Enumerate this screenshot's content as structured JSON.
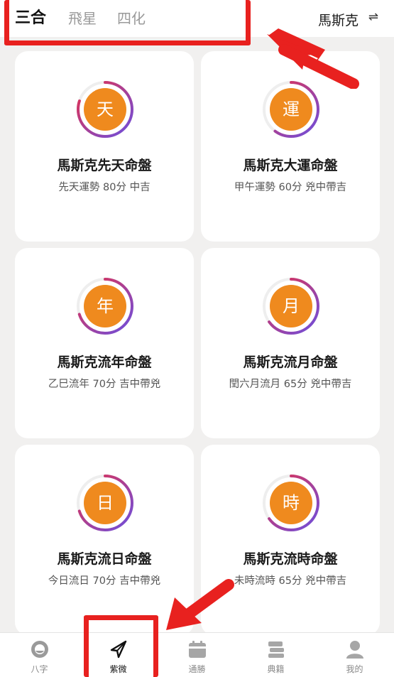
{
  "header": {
    "tabs": [
      {
        "label": "三合",
        "active": true
      },
      {
        "label": "飛星",
        "active": false
      },
      {
        "label": "四化",
        "active": false
      }
    ],
    "user_name": "馬斯克",
    "switch_icon": "⇌"
  },
  "cards": [
    {
      "badge": "天",
      "title": "馬斯克先天命盤",
      "subtitle": "先天運勢  80分 中吉",
      "score": 80
    },
    {
      "badge": "運",
      "title": "馬斯克大運命盤",
      "subtitle": "甲午運勢  60分 兇中帶吉",
      "score": 60
    },
    {
      "badge": "年",
      "title": "馬斯克流年命盤",
      "subtitle": "乙巳流年  70分 吉中帶兇",
      "score": 70
    },
    {
      "badge": "月",
      "title": "馬斯克流月命盤",
      "subtitle": "閏六月流月  65分 兇中帶吉",
      "score": 65
    },
    {
      "badge": "日",
      "title": "馬斯克流日命盤",
      "subtitle": "今日流日  70分 吉中帶兇",
      "score": 70
    },
    {
      "badge": "時",
      "title": "馬斯克流時命盤",
      "subtitle": "未時流時 65分 兇中帶吉",
      "score": 65
    }
  ],
  "bottom_nav": [
    {
      "label": "八字",
      "icon": "bazi-icon",
      "active": false
    },
    {
      "label": "紫微",
      "icon": "ziwei-icon",
      "active": true
    },
    {
      "label": "通勝",
      "icon": "calendar-icon",
      "active": false
    },
    {
      "label": "典籍",
      "icon": "books-icon",
      "active": false
    },
    {
      "label": "我的",
      "icon": "profile-icon",
      "active": false
    }
  ],
  "colors": {
    "accent": "#ef8a1e",
    "ring_start": "#6b4fe0",
    "ring_end": "#e8304a",
    "annotation": "#e8211f"
  }
}
